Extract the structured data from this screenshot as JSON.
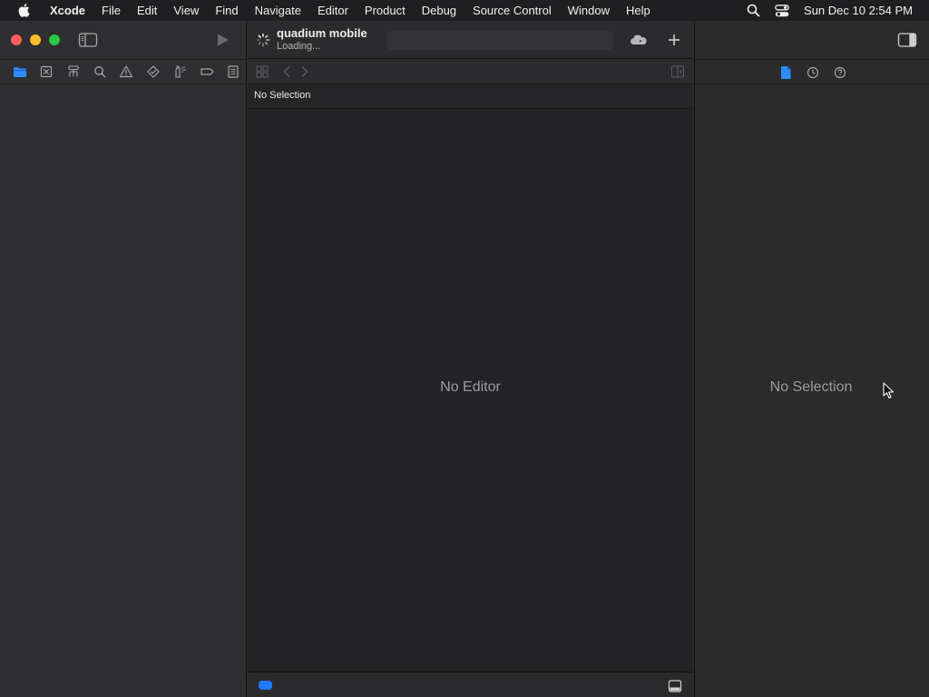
{
  "menubar": {
    "app": "Xcode",
    "items": [
      "File",
      "Edit",
      "View",
      "Find",
      "Navigate",
      "Editor",
      "Product",
      "Debug",
      "Source Control",
      "Window",
      "Help"
    ],
    "clock": "Sun Dec 10  2:54 PM",
    "icons": [
      "apple-logo-icon",
      "search-icon",
      "control-center-icon"
    ]
  },
  "window": {
    "project_name": "quadium mobile",
    "project_status": "Loading...",
    "navigator_tabs": [
      "folder-icon",
      "source-control-icon",
      "hierarchy-icon",
      "search-icon",
      "warning-icon",
      "test-diamond-icon",
      "debug-spray-icon",
      "breakpoint-icon",
      "report-icon"
    ],
    "path_label": "No Selection",
    "editor_placeholder": "No Editor",
    "inspector_placeholder": "No Selection",
    "inspector_tabs": [
      "file-inspector-icon",
      "history-icon",
      "help-icon"
    ]
  },
  "colors": {
    "accent": "#1f7aff",
    "close": "#fe5f57",
    "minimize": "#febc2e",
    "zoom": "#28c840"
  }
}
